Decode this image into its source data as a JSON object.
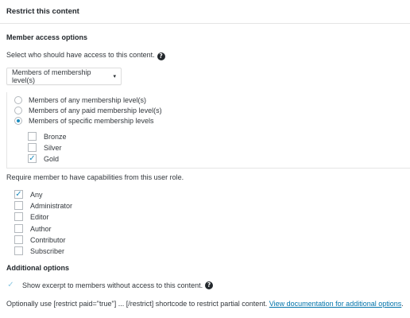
{
  "panel": {
    "title": "Restrict this content"
  },
  "member_access": {
    "heading": "Member access options",
    "prompt": "Select who should have access to this content.",
    "help_icon": "?",
    "select_value": "Members of membership level(s)",
    "select_caret": "▾",
    "radio_options": [
      {
        "label": "Members of any membership level(s)",
        "checked": false
      },
      {
        "label": "Members of any paid membership level(s)",
        "checked": false
      },
      {
        "label": "Members of specific membership levels",
        "checked": true
      }
    ],
    "levels": [
      {
        "label": "Bronze",
        "checked": false
      },
      {
        "label": "Silver",
        "checked": false
      },
      {
        "label": "Gold",
        "checked": true
      }
    ]
  },
  "capabilities": {
    "prompt": "Require member to have capabilities from this user role.",
    "roles": [
      {
        "label": "Any",
        "checked": true
      },
      {
        "label": "Administrator",
        "checked": false
      },
      {
        "label": "Editor",
        "checked": false
      },
      {
        "label": "Author",
        "checked": false
      },
      {
        "label": "Contributor",
        "checked": false
      },
      {
        "label": "Subscriber",
        "checked": false
      }
    ]
  },
  "additional": {
    "heading": "Additional options",
    "excerpt_label": "Show excerpt to members without access to this content.",
    "excerpt_checked": true,
    "help_icon": "?",
    "shortcode_note": "Optionally use [restrict paid=\"true\"] ... [/restrict] shortcode to restrict partial content.",
    "doc_link": "View documentation for additional options",
    "doc_link_suffix": "."
  },
  "colors": {
    "accent": "#1e8cbe",
    "link": "#0073aa",
    "border": "#e5e5e5"
  },
  "icons": {
    "checkmark": "✓"
  }
}
